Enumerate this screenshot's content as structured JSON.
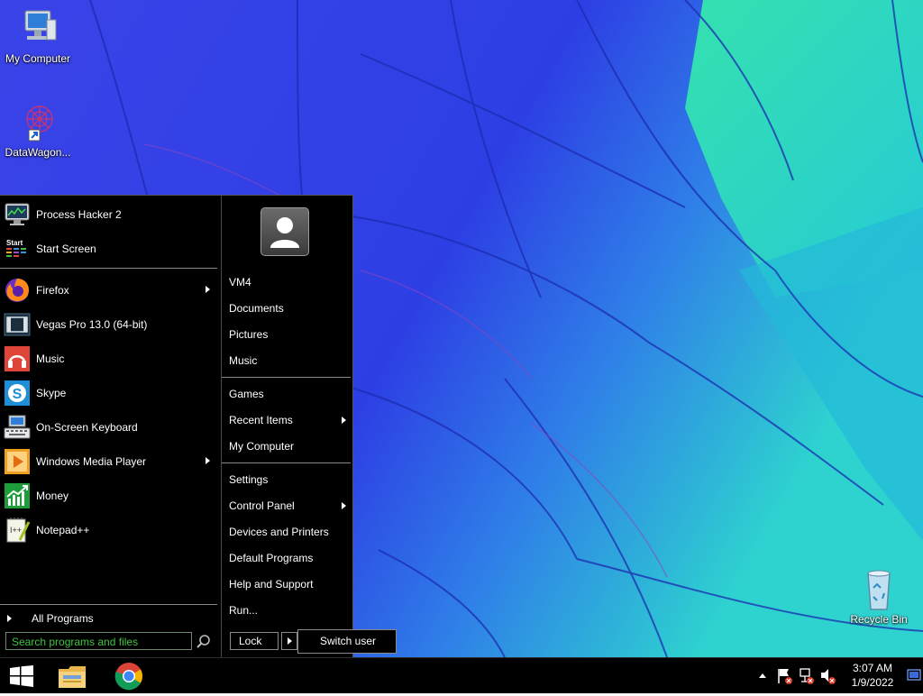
{
  "desktop": {
    "icons": [
      {
        "label": "My Computer",
        "icon": "my-computer-icon"
      },
      {
        "label": "DataWagon...",
        "icon": "datawagon-shortcut-icon"
      },
      {
        "label": "Recycle Bin",
        "icon": "recycle-bin-icon"
      }
    ]
  },
  "start_menu": {
    "pinned": [
      {
        "label": "Process Hacker 2",
        "icon": "process-hacker-icon"
      },
      {
        "label": "Start Screen",
        "icon": "start-screen-icon"
      }
    ],
    "recent": [
      {
        "label": "Firefox",
        "icon": "firefox-icon",
        "submenu": true
      },
      {
        "label": "Vegas Pro 13.0 (64-bit)",
        "icon": "vegas-pro-icon",
        "submenu": false
      },
      {
        "label": "Music",
        "icon": "music-icon",
        "submenu": false
      },
      {
        "label": "Skype",
        "icon": "skype-icon",
        "submenu": false
      },
      {
        "label": "On-Screen Keyboard",
        "icon": "keyboard-icon",
        "submenu": false
      },
      {
        "label": "Windows Media Player",
        "icon": "media-player-icon",
        "submenu": true
      },
      {
        "label": "Money",
        "icon": "money-icon",
        "submenu": false
      },
      {
        "label": "Notepad++",
        "icon": "notepadpp-icon",
        "submenu": false
      }
    ],
    "all_programs": "All Programs",
    "search_placeholder": "Search programs and files",
    "right_links": [
      {
        "label": "VM4"
      },
      {
        "label": "Documents"
      },
      {
        "label": "Pictures"
      },
      {
        "label": "Music"
      },
      {
        "label": "Games"
      },
      {
        "label": "Recent Items",
        "submenu": true
      },
      {
        "label": "My Computer"
      },
      {
        "label": "Settings"
      },
      {
        "label": "Control Panel",
        "submenu": true
      },
      {
        "label": "Devices and Printers"
      },
      {
        "label": "Default Programs"
      },
      {
        "label": "Help and Support"
      },
      {
        "label": "Run..."
      }
    ],
    "lock_label": "Lock",
    "switch_user_label": "Switch user"
  },
  "taskbar": {
    "apps": [
      {
        "name": "File Explorer",
        "icon": "file-explorer-icon"
      },
      {
        "name": "Google Chrome",
        "icon": "chrome-icon"
      }
    ],
    "clock": {
      "time": "3:07 AM",
      "date": "1/9/2022"
    }
  },
  "colors": {
    "wallpaper_blue": "#2f3fe0",
    "wallpaper_cyan": "#2fd7c8",
    "menu_bg": "#000000",
    "search_text": "#3fc43f"
  }
}
